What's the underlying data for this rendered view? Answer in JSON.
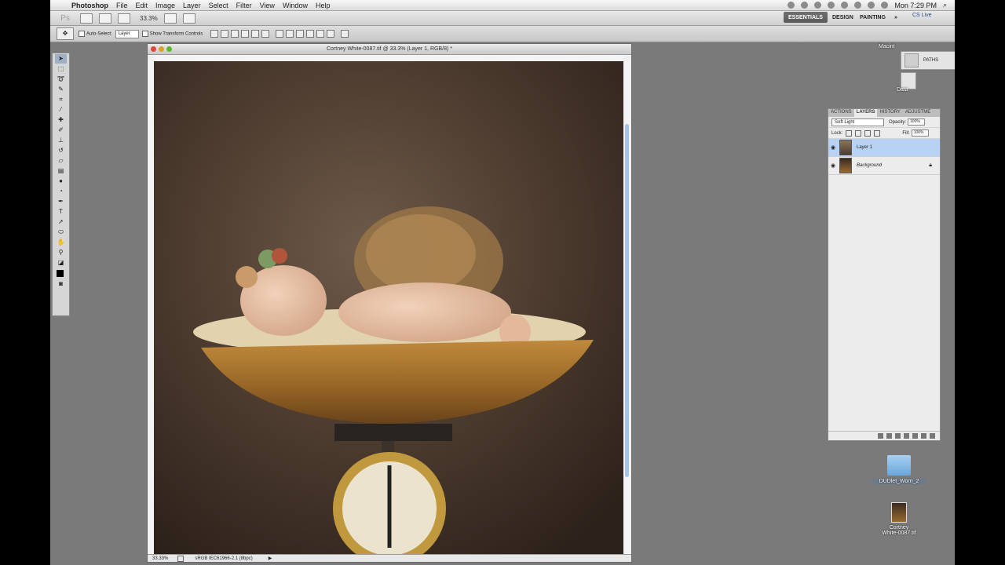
{
  "menubar": {
    "app_name": "Photoshop",
    "items": [
      "File",
      "Edit",
      "Image",
      "Layer",
      "Select",
      "Filter",
      "View",
      "Window",
      "Help"
    ],
    "clock": "Mon 7:29 PM"
  },
  "appbar": {
    "logo": "Ps",
    "zoom": "33.3%",
    "workspaces": [
      "ESSENTIALS",
      "DESIGN",
      "PAINTING"
    ],
    "more": "»",
    "cslive": "CS Live"
  },
  "options": {
    "auto_select": "Auto-Select:",
    "auto_select_mode": "Layer",
    "transform": "Show Transform Controls"
  },
  "document": {
    "title": "Cortney White-0087.tif @ 33.3% (Layer 1, RGB/8) *",
    "status_zoom": "33.33%",
    "status_profile": "sRGB IEC61966-2.1 (8bpc)"
  },
  "mini_panel": {
    "paths_label": "PATHS"
  },
  "layers_panel": {
    "tabs": [
      "ACTIONS",
      "LAYERS",
      "HISTORY",
      "ADJUSTME"
    ],
    "blend_mode": "Soft Light",
    "opacity_label": "Opacity:",
    "opacity_value": "100%",
    "lock_label": "Lock:",
    "fill_label": "Fill:",
    "fill_value": "100%",
    "layers": [
      {
        "name": "Layer 1"
      },
      {
        "name": "Background"
      }
    ]
  },
  "desktop": {
    "drive_label": "Macint",
    "data_label": "Data",
    "folder_label": "DUDlet_Worn_2",
    "file_label_1": "Cortney",
    "file_label_2": "White-0087.tif"
  },
  "colors": {
    "accent": "#b7d2f2",
    "canvas_bg": "#4d3c30",
    "workspace_bg": "#7a7a7a"
  }
}
